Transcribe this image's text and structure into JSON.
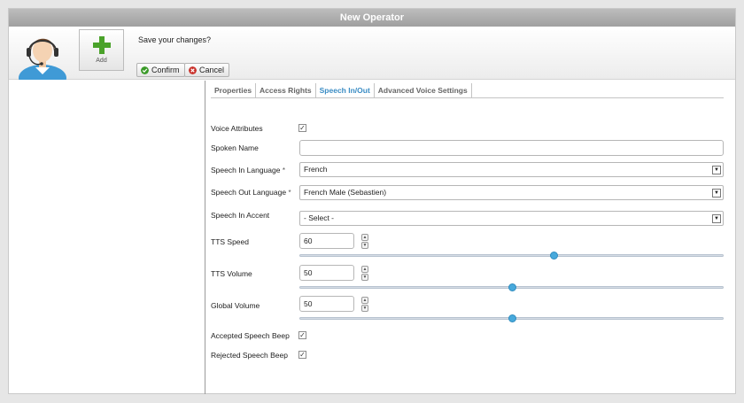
{
  "window": {
    "title": "New Operator"
  },
  "header": {
    "add_label": "Add",
    "question": "Save your changes?",
    "confirm_label": "Confirm",
    "cancel_label": "Cancel"
  },
  "tabs": [
    {
      "label": "Properties",
      "active": false
    },
    {
      "label": "Access Rights",
      "active": false
    },
    {
      "label": "Speech In/Out",
      "active": true
    },
    {
      "label": "Advanced Voice Settings",
      "active": false
    }
  ],
  "form": {
    "voice_attributes": {
      "label": "Voice  Attributes",
      "checked": true
    },
    "spoken_name": {
      "label": "Spoken Name",
      "value": ""
    },
    "speech_in_language": {
      "label": "Speech In Language",
      "required_mark": "*",
      "value": "French"
    },
    "speech_out_language": {
      "label": "Speech Out Language",
      "required_mark": "*",
      "value": "French Male (Sebastien)"
    },
    "speech_in_accent": {
      "label": "Speech In Accent",
      "value": "- Select -"
    },
    "tts_speed": {
      "label": "TTS Speed",
      "value": "60",
      "slider_fraction": 0.6
    },
    "tts_volume": {
      "label": "TTS Volume",
      "value": "50",
      "slider_fraction": 0.5
    },
    "global_volume": {
      "label": "Global Volume",
      "value": "50",
      "slider_fraction": 0.5
    },
    "accepted_beep": {
      "label": "Accepted Speech Beep",
      "checked": true
    },
    "rejected_beep": {
      "label": "Rejected Speech Beep",
      "checked": true
    }
  },
  "icons": {
    "add": "plus-icon",
    "confirm": "check-circle-icon",
    "cancel": "x-circle-icon",
    "avatar": "operator-headset-avatar",
    "dropdown": "triangle-down-icon",
    "stepper_up": "triangle-up-icon",
    "stepper_down": "triangle-down-icon"
  },
  "colors": {
    "active_tab": "#3a8cc4",
    "slider_thumb": "#47a9dc",
    "add_green": "#4aa22a",
    "confirm_green": "#3a9a28",
    "cancel_red": "#c9312a"
  },
  "glyphs": {
    "check": "✓",
    "down": "▼",
    "up": "▲"
  }
}
